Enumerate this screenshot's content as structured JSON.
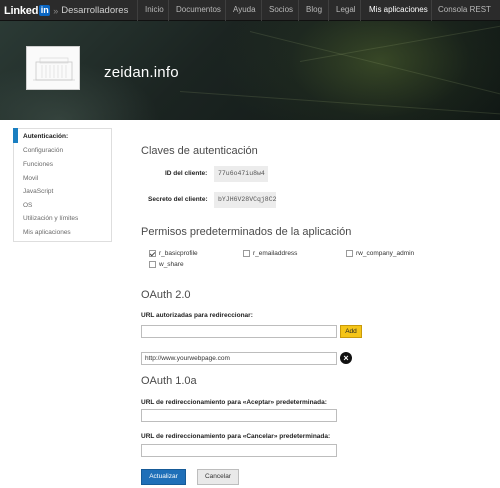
{
  "brand": {
    "linked": "Linked",
    "in": "in",
    "separator": "»",
    "section": "Desarrolladores"
  },
  "nav": {
    "items": [
      {
        "label": "Inicio"
      },
      {
        "label": "Documentos"
      },
      {
        "label": "Ayuda"
      },
      {
        "label": "Socios"
      },
      {
        "label": "Blog"
      },
      {
        "label": "Legal"
      },
      {
        "label": "Mis aplicaciones",
        "active": true
      },
      {
        "label": "Consola REST"
      }
    ]
  },
  "app": {
    "name": "zeidan.info"
  },
  "sidebar": {
    "items": [
      {
        "label": "Autenticación:",
        "active": true
      },
      {
        "label": "Configuración"
      },
      {
        "label": "Funciones"
      },
      {
        "label": "Movil"
      },
      {
        "label": "JavaScript"
      },
      {
        "label": "OS"
      },
      {
        "label": "Utilización y límites"
      },
      {
        "label": "Mis aplicaciones"
      }
    ]
  },
  "auth": {
    "title": "Claves de autenticación",
    "client_id_label": "ID del cliente:",
    "client_id_value": "77u6o47iu8w4",
    "client_secret_label": "Secreto del cliente:",
    "client_secret_value": "bYJH6V28VCqj8C2"
  },
  "permissions": {
    "title": "Permisos predeterminados de la aplicación",
    "items": [
      {
        "label": "r_basicprofile",
        "checked": true
      },
      {
        "label": "r_emailaddress",
        "checked": false
      },
      {
        "label": "rw_company_admin",
        "checked": false
      },
      {
        "label": "w_share",
        "checked": false
      }
    ]
  },
  "oauth2": {
    "title": "OAuth 2.0",
    "redirect_label": "URL autorizadas para redireccionar:",
    "redirect_input_value": "",
    "add_label": "Add",
    "urls": [
      "http://www.yourwebpage.com"
    ]
  },
  "oauth1": {
    "title": "OAuth 1.0a",
    "accept_label": "URL de redireccionamiento para «Aceptar» predeterminada:",
    "accept_value": "",
    "cancel_label": "URL de redireccionamiento para «Cancelar» predeterminada:",
    "cancel_value": ""
  },
  "actions": {
    "update": "Actualizar",
    "cancel": "Cancelar"
  },
  "colors": {
    "accent": "#1f6fb8",
    "add_button": "#f5c518",
    "nav_bg": "#2b2b2b"
  }
}
